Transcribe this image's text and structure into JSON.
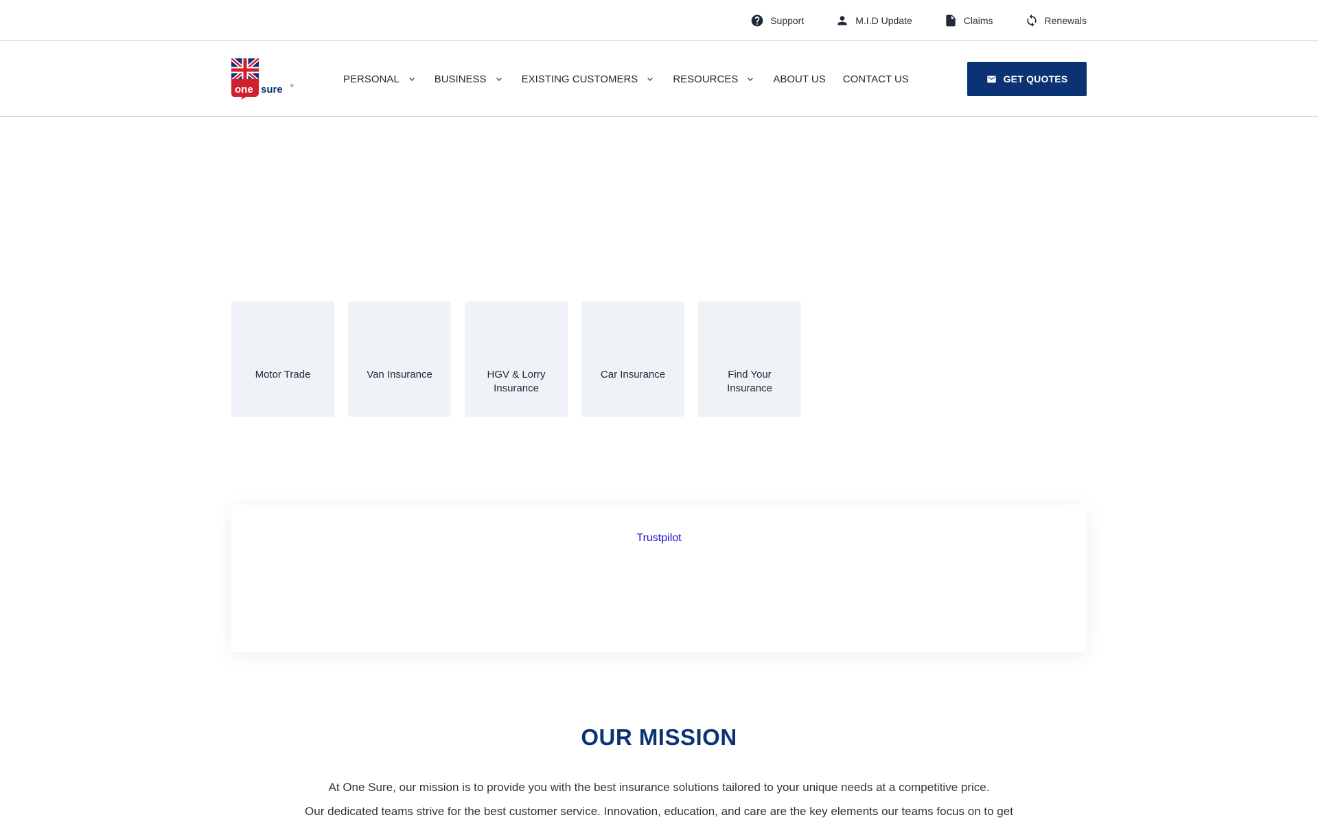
{
  "topbar": {
    "links": [
      {
        "label": "Support",
        "icon": "help-circle-icon"
      },
      {
        "label": "M.I.D Update",
        "icon": "person-icon"
      },
      {
        "label": "Claims",
        "icon": "document-icon"
      },
      {
        "label": "Renewals",
        "icon": "refresh-icon"
      }
    ]
  },
  "header": {
    "logo_text": "one sure",
    "nav": [
      {
        "label": "PERSONAL",
        "dropdown": true
      },
      {
        "label": "BUSINESS",
        "dropdown": true
      },
      {
        "label": "EXISTING CUSTOMERS",
        "dropdown": true
      },
      {
        "label": "RESOURCES",
        "dropdown": true
      },
      {
        "label": "ABOUT US",
        "dropdown": false
      },
      {
        "label": "CONTACT US",
        "dropdown": false
      }
    ],
    "cta_label": "GET QUOTES",
    "cta_icon": "mail-icon"
  },
  "tiles": [
    {
      "label": "Motor Trade"
    },
    {
      "label": "Van Insurance"
    },
    {
      "label": "HGV & Lorry Insurance"
    },
    {
      "label": "Car Insurance"
    },
    {
      "label": "Find Your Insurance"
    }
  ],
  "trustpilot": {
    "link_label": "Trustpilot"
  },
  "mission": {
    "title": "OUR MISSION",
    "line1": "At One Sure, our mission is to provide you with the best insurance solutions tailored to your unique needs at a competitive price.",
    "line2": "Our dedicated teams strive for the best customer service. Innovation, education, and care are the key elements our teams focus on to get"
  },
  "colors": {
    "brand_navy": "#0b3374",
    "tile_bg": "#eff2f7",
    "logo_red": "#d0202e",
    "link_blue": "#1a0dcc"
  }
}
